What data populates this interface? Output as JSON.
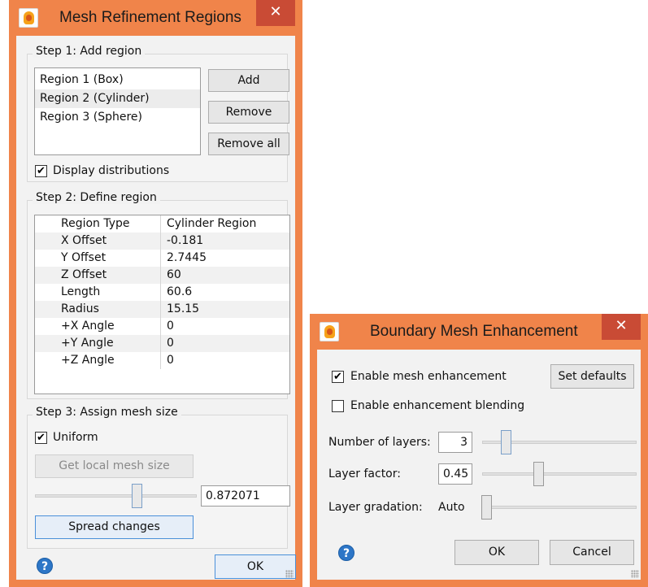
{
  "mesh_dialog": {
    "title": "Mesh Refinement Regions",
    "close_glyph": "✕",
    "step1": {
      "title": "Step 1: Add region",
      "regions": [
        "Region 1 (Box)",
        "Region 2 (Cylinder)",
        "Region 3 (Sphere)"
      ],
      "add_label": "Add",
      "remove_label": "Remove",
      "remove_all_label": "Remove all",
      "display_distributions_label": "Display distributions"
    },
    "step2": {
      "title": "Step 2: Define region",
      "rows": [
        [
          "Region Type",
          "Cylinder Region"
        ],
        [
          "X Offset",
          "-0.181"
        ],
        [
          "Y Offset",
          "2.7445"
        ],
        [
          "Z Offset",
          "60"
        ],
        [
          "Length",
          "60.6"
        ],
        [
          "Radius",
          "15.15"
        ],
        [
          "+X Angle",
          "0"
        ],
        [
          "+Y Angle",
          "0"
        ],
        [
          "+Z Angle",
          "0"
        ]
      ]
    },
    "step3": {
      "title": "Step 3: Assign mesh size",
      "uniform_label": "Uniform",
      "get_local_label": "Get local mesh size",
      "mesh_size_value": "0.872071",
      "spread_label": "Spread changes"
    },
    "ok_label": "OK",
    "help_glyph": "?"
  },
  "boundary_dialog": {
    "title": "Boundary Mesh Enhancement",
    "close_glyph": "✕",
    "enable_label": "Enable mesh enhancement",
    "blending_label": "Enable enhancement blending",
    "set_defaults_label": "Set defaults",
    "layers_label": "Number of layers:",
    "layers_value": "3",
    "factor_label": "Layer factor:",
    "factor_value": "0.45",
    "gradation_label": "Layer gradation:",
    "gradation_value": "Auto",
    "ok_label": "OK",
    "cancel_label": "Cancel",
    "help_glyph": "?"
  },
  "check_glyph": "✔",
  "colors": {
    "title_bar": "#f0844a",
    "close_button": "#c94b35",
    "help_icon": "#2d76c7"
  }
}
